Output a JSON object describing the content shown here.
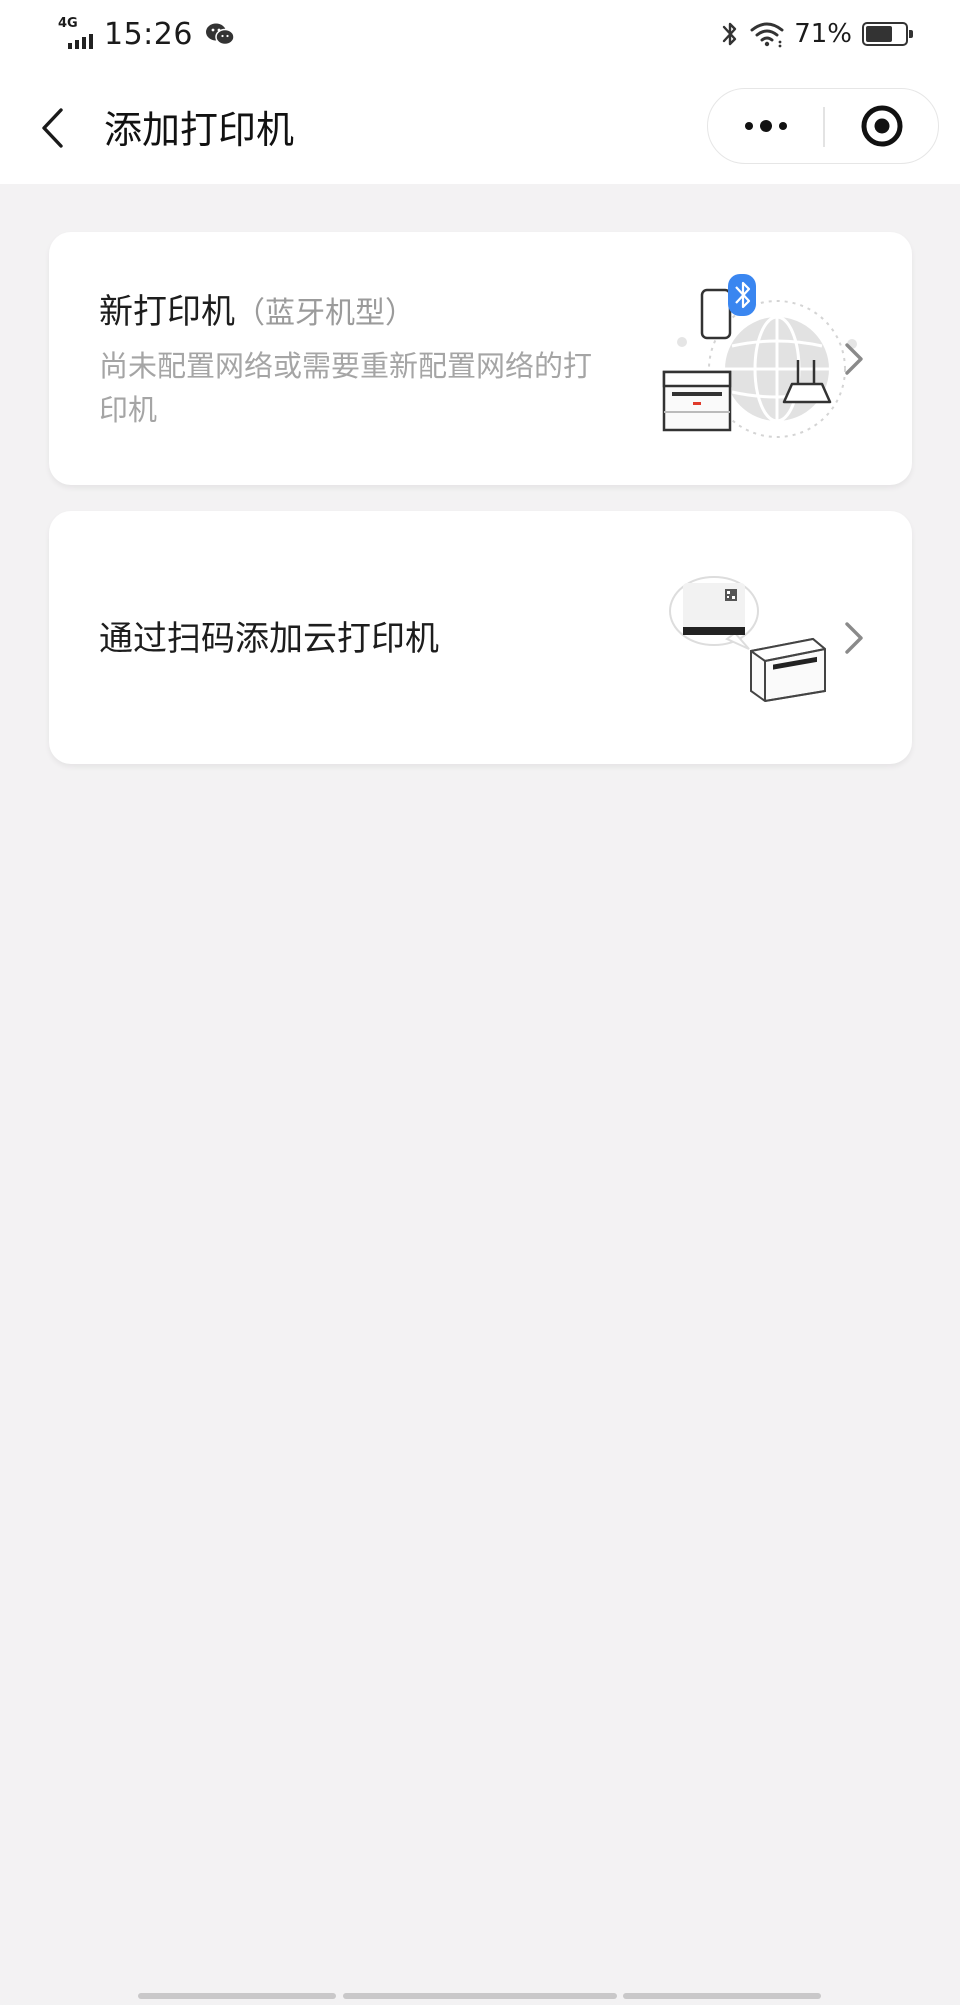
{
  "status_bar": {
    "network": "4G",
    "time": "15:26",
    "battery_percent": "71%",
    "battery_level": 0.71,
    "icons": [
      "signal-icon",
      "wechat-icon",
      "bluetooth-icon",
      "wifi-icon",
      "battery-icon"
    ]
  },
  "nav": {
    "title": "添加打印机",
    "back_icon": "chevron-left-icon",
    "more_icon": "more-dots-icon",
    "close_icon": "target-close-icon"
  },
  "options": [
    {
      "title": "新打印机",
      "note": "（蓝牙机型）",
      "description": "尚未配置网络或需要重新配置网络的打印机",
      "illustration": "bluetooth-printer-illustration"
    },
    {
      "title": "通过扫码添加云打印机",
      "illustration": "scan-printer-illustration"
    }
  ],
  "colors": {
    "page_bg": "#f3f2f3",
    "card_bg": "#ffffff",
    "bluetooth_accent": "#3a86f0",
    "printer_accent": "#e03b2b",
    "secondary_text": "#a5a5a5"
  }
}
